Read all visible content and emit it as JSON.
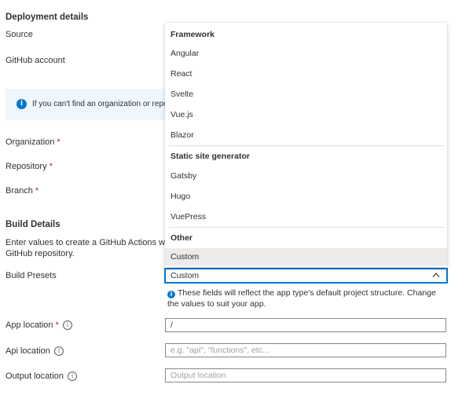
{
  "deployment": {
    "title": "Deployment details",
    "source_label": "Source",
    "github_account_label": "GitHub account",
    "info_banner": "If you can't find an organization or repo",
    "organization_label": "Organization",
    "repository_label": "Repository",
    "branch_label": "Branch",
    "required_marker": "*"
  },
  "build": {
    "title": "Build Details",
    "description_line1": "Enter values to create a GitHub Actions wor",
    "description_line2": "GitHub repository.",
    "presets_label": "Build Presets",
    "presets_value": "Custom",
    "hint_line1": "These fields will reflect the app type's default project structure. Change",
    "hint_line2": "the values to suit your app.",
    "app_location_label": "App location",
    "app_location_value": "/",
    "api_location_label": "Api location",
    "api_location_placeholder": "e.g. \"api\", \"functions\", etc...",
    "output_location_label": "Output location",
    "output_location_placeholder": "Output location"
  },
  "dropdown": {
    "groups": [
      {
        "header": "Framework",
        "items": [
          "Angular",
          "React",
          "Svelte",
          "Vue.js",
          "Blazor"
        ]
      },
      {
        "header": "Static site generator",
        "items": [
          "Gatsby",
          "Hugo",
          "VuePress"
        ]
      },
      {
        "header": "Other",
        "items": [
          "Custom"
        ]
      }
    ],
    "selected": "Custom"
  },
  "colors": {
    "accent": "#0078d4",
    "required": "#a4262c",
    "banner_bg": "#eff6fc",
    "selected_bg": "#edebe9"
  },
  "icons": {
    "info": "info-icon",
    "chevron": "chevron-up-icon"
  }
}
